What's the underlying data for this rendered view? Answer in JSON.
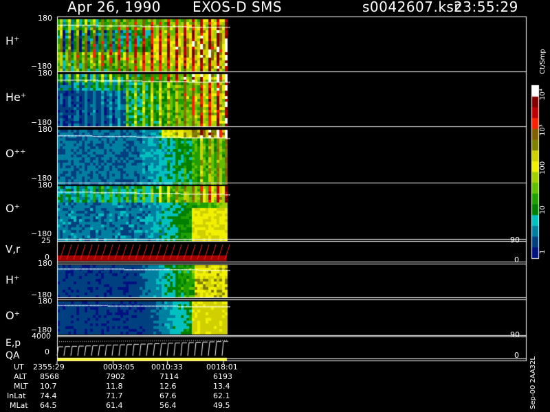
{
  "header": {
    "date": "Apr 26, 1990",
    "instrument": "EXOS-D SMS",
    "file": "s0042607.ksr",
    "time": "23:55:29"
  },
  "colorbar": {
    "unit_label": "Ct/Smp",
    "ticks": [
      "10⁴",
      "10³",
      "100",
      "10",
      "1"
    ],
    "colors": [
      "#ffffff",
      "#800000",
      "#c00000",
      "#ff2000",
      "#806000",
      "#808000",
      "#d0d000",
      "#f0f000",
      "#a0d000",
      "#60c000",
      "#20a000",
      "#008000",
      "#00c0c0",
      "#0080a0",
      "#004080",
      "#001080"
    ]
  },
  "panels": [
    {
      "id": "h-plus",
      "label": "H⁺",
      "ticks": [
        "180",
        "−180"
      ]
    },
    {
      "id": "he-plus",
      "label": "He⁺",
      "ticks": [
        "180",
        "−180"
      ]
    },
    {
      "id": "o-plusplus",
      "label": "O⁺⁺",
      "ticks": [
        "180",
        "−180"
      ]
    },
    {
      "id": "o-plus",
      "label": "O⁺",
      "ticks": [
        "180",
        "−180"
      ]
    },
    {
      "id": "vr",
      "label": "V,r",
      "ticks": [
        "25",
        "0"
      ],
      "right_ticks": [
        "90",
        "0"
      ]
    },
    {
      "id": "h-plus-2",
      "label": "H⁺",
      "ticks": [
        "180",
        "−180"
      ]
    },
    {
      "id": "o-plus-2",
      "label": "O⁺",
      "ticks": [
        "180",
        "−180"
      ]
    },
    {
      "id": "ep",
      "label": "E,p",
      "ticks": [
        "4000",
        "0"
      ],
      "right_ticks": [
        "90",
        "0"
      ]
    },
    {
      "id": "qa",
      "label": "QA"
    }
  ],
  "ut_table": {
    "rows": [
      {
        "name": "UT",
        "values": [
          "2355:29",
          "0003:05",
          "0010:33",
          "0018:01"
        ]
      },
      {
        "name": "ALT",
        "values": [
          "8568",
          "7902",
          "7114",
          "6193"
        ]
      },
      {
        "name": "MLT",
        "values": [
          "10.7",
          "11.8",
          "12.6",
          "13.4"
        ]
      },
      {
        "name": "InLat",
        "values": [
          "74.4",
          "71.7",
          "67.6",
          "62.1"
        ]
      },
      {
        "name": "MLat",
        "values": [
          "64.5",
          "61.4",
          "56.4",
          "49.5"
        ]
      }
    ]
  },
  "footer": {
    "id": "Sep-00  2AA32L"
  },
  "chart_data": {
    "type": "heatmap",
    "title": "Apr 26, 1990   EXOS-D SMS",
    "x": [
      "2355:29",
      "0003:05",
      "0010:33",
      "0018:01"
    ],
    "xlabel": "UT",
    "panels": [
      {
        "name": "H⁺",
        "ylim": [
          -180,
          180
        ]
      },
      {
        "name": "He⁺",
        "ylim": [
          -180,
          180
        ]
      },
      {
        "name": "O⁺⁺",
        "ylim": [
          -180,
          180
        ]
      },
      {
        "name": "O⁺",
        "ylim": [
          -180,
          180
        ]
      },
      {
        "name": "V,r",
        "ylim": [
          0,
          25
        ],
        "right_ylim": [
          0,
          90
        ]
      },
      {
        "name": "H⁺",
        "ylim": [
          -180,
          180
        ]
      },
      {
        "name": "O⁺",
        "ylim": [
          -180,
          180
        ]
      },
      {
        "name": "E,p",
        "ylim": [
          0,
          4000
        ],
        "right_ylim": [
          0,
          90
        ]
      }
    ],
    "colorscale": {
      "unit": "Ct/Smp",
      "scale": "log",
      "range": [
        1,
        10000
      ]
    }
  }
}
